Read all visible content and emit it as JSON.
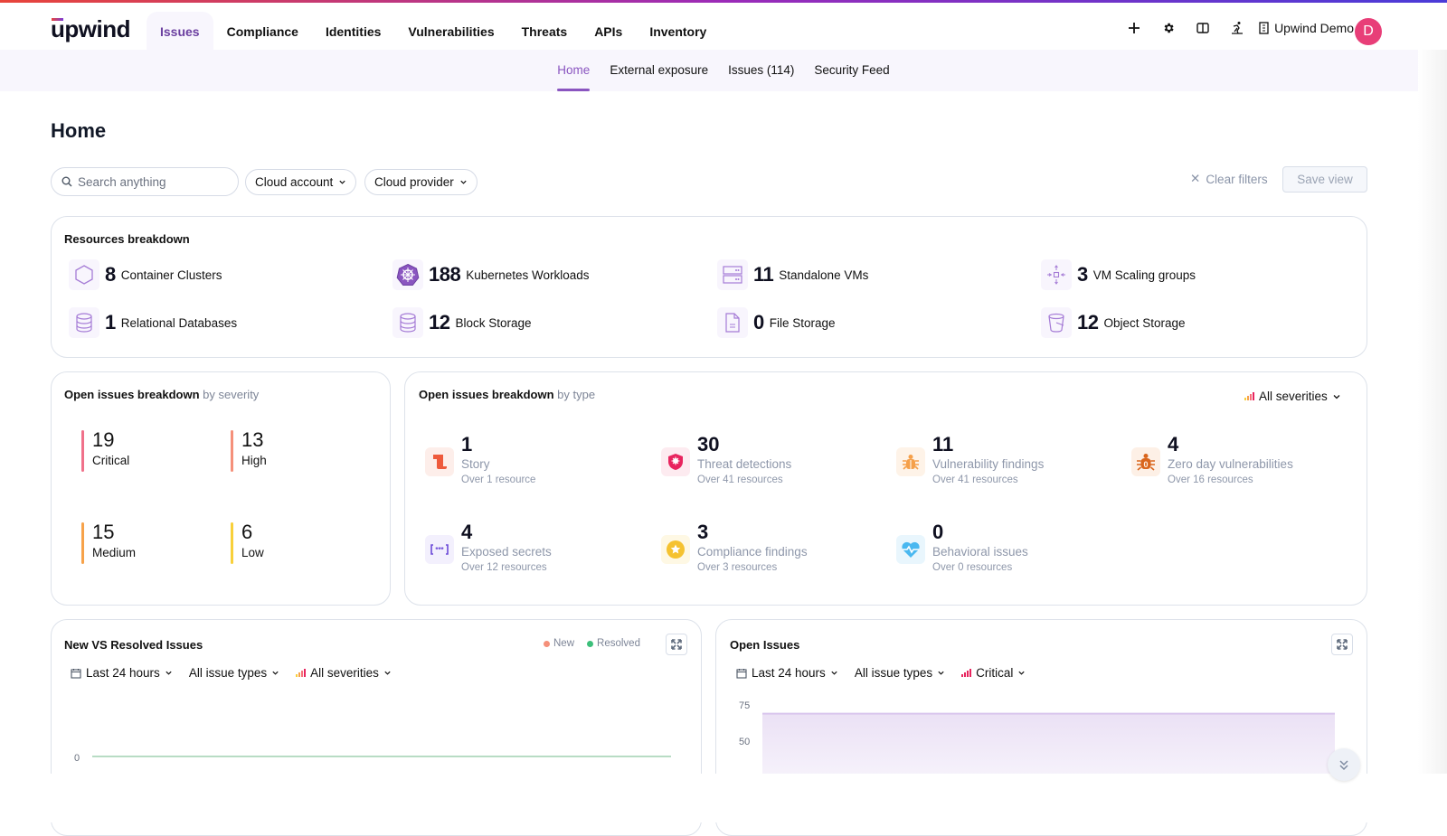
{
  "brand": {
    "name": "upwind"
  },
  "main_nav": [
    {
      "label": "Issues",
      "active": true
    },
    {
      "label": "Compliance"
    },
    {
      "label": "Identities"
    },
    {
      "label": "Vulnerabilities"
    },
    {
      "label": "Threats"
    },
    {
      "label": "APIs"
    },
    {
      "label": "Inventory"
    }
  ],
  "topbar": {
    "icons": [
      "plus-icon",
      "gear-icon",
      "book-icon",
      "onboarding-icon"
    ],
    "org_label": "Upwind Demo",
    "avatar_initial": "D",
    "avatar_color": "#e83e78"
  },
  "sub_nav": [
    {
      "label": "Home",
      "active": true
    },
    {
      "label": "External exposure"
    },
    {
      "label": "Issues (114)"
    },
    {
      "label": "Security Feed"
    }
  ],
  "page": {
    "title": "Home"
  },
  "filters": {
    "search_placeholder": "Search anything",
    "cloud_account": "Cloud account",
    "cloud_provider": "Cloud provider",
    "clear_filters": "Clear filters",
    "save_view": "Save view"
  },
  "resources": {
    "title": "Resources breakdown",
    "items": [
      {
        "count": "8",
        "label": "Container Clusters",
        "icon": "hexagon-icon"
      },
      {
        "count": "188",
        "label": "Kubernetes Workloads",
        "icon": "kubernetes-icon"
      },
      {
        "count": "11",
        "label": "Standalone VMs",
        "icon": "server-icon"
      },
      {
        "count": "3",
        "label": "VM Scaling groups",
        "icon": "scaling-icon"
      },
      {
        "count": "1",
        "label": "Relational Databases",
        "icon": "database-icon"
      },
      {
        "count": "12",
        "label": "Block Storage",
        "icon": "block-storage-icon"
      },
      {
        "count": "0",
        "label": "File Storage",
        "icon": "file-icon"
      },
      {
        "count": "12",
        "label": "Object Storage",
        "icon": "bucket-icon"
      }
    ]
  },
  "severity": {
    "title": "Open issues breakdown",
    "subtitle": "by severity",
    "items": [
      {
        "count": "19",
        "label": "Critical",
        "color": "#f0718a"
      },
      {
        "count": "13",
        "label": "High",
        "color": "#f5907a"
      },
      {
        "count": "15",
        "label": "Medium",
        "color": "#f7a24a"
      },
      {
        "count": "6",
        "label": "Low",
        "color": "#f8d03a"
      }
    ]
  },
  "types": {
    "title": "Open issues breakdown",
    "subtitle": "by type",
    "severity_filter": "All severities",
    "items": [
      {
        "count": "1",
        "label": "Story",
        "sub": "Over 1 resource",
        "icon": "story-icon",
        "color": "#ee5a3c",
        "bg": "#fdeeea"
      },
      {
        "count": "30",
        "label": "Threat detections",
        "sub": "Over 41 resources",
        "icon": "shield-virus-icon",
        "color": "#e8245e",
        "bg": "#fdebf0"
      },
      {
        "count": "11",
        "label": "Vulnerability findings",
        "sub": "Over 41 resources",
        "icon": "bug-icon",
        "color": "#f5a04a",
        "bg": "#fef3e8"
      },
      {
        "count": "4",
        "label": "Zero day vulnerabilities",
        "sub": "Over 16 resources",
        "icon": "zero-day-bug-icon",
        "color": "#d9651c",
        "bg": "#fdf0e6"
      },
      {
        "count": "4",
        "label": "Exposed secrets",
        "sub": "Over 12 resources",
        "icon": "secrets-icon",
        "color": "#6c4ad8",
        "bg": "#f3f0fd"
      },
      {
        "count": "3",
        "label": "Compliance findings",
        "sub": "Over 3 resources",
        "icon": "compliance-star-icon",
        "color": "#f5c230",
        "bg": "#fef8e4"
      },
      {
        "count": "0",
        "label": "Behavioral issues",
        "sub": "Over 0 resources",
        "icon": "heartbeat-icon",
        "color": "#4ab8f0",
        "bg": "#e9f6fd"
      }
    ]
  },
  "new_vs_resolved": {
    "title": "New VS Resolved Issues",
    "legend": [
      {
        "label": "New",
        "color": "#f5907a"
      },
      {
        "label": "Resolved",
        "color": "#3cbf7a"
      }
    ],
    "time_filter": "Last 24 hours",
    "type_filter": "All issue types",
    "severity_filter": "All severities",
    "chart_data": {
      "type": "line",
      "series": [
        {
          "name": "Resolved",
          "values": [
            0,
            0
          ]
        }
      ],
      "y_ticks": [
        "0"
      ],
      "ylim": [
        0,
        0
      ]
    }
  },
  "open_issues": {
    "title": "Open Issues",
    "time_filter": "Last 24 hours",
    "type_filter": "All issue types",
    "severity_filter": "Critical",
    "chart_data": {
      "type": "area",
      "series": [
        {
          "name": "Critical",
          "values": [
            69,
            69
          ]
        }
      ],
      "y_ticks": [
        "75",
        "50"
      ],
      "ylim": [
        0,
        75
      ]
    }
  }
}
